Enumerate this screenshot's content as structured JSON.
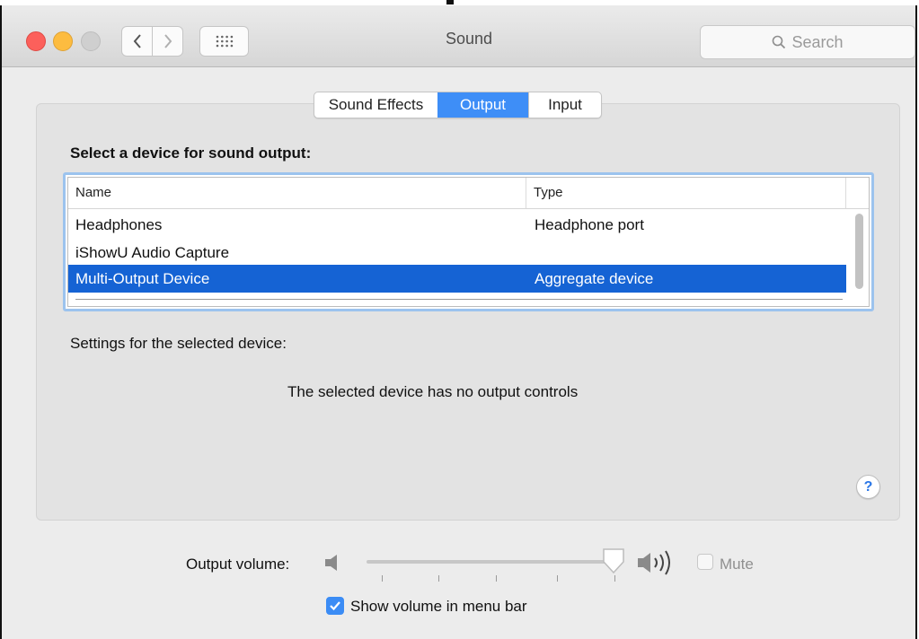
{
  "window": {
    "title": "Sound",
    "search_placeholder": "Search"
  },
  "icons": {
    "close": "close-light",
    "minimize": "minimize-light",
    "zoom": "zoom-light-disabled",
    "back": "chevron-left-icon",
    "forward": "chevron-right-icon",
    "show_all": "grid-icon",
    "search": "magnifier-icon",
    "help": "question-icon",
    "speaker_low": "speaker-low-icon",
    "speaker_high": "speaker-high-icon",
    "check": "checkmark-icon"
  },
  "tabs": [
    {
      "label": "Sound Effects",
      "selected": false
    },
    {
      "label": "Output",
      "selected": true
    },
    {
      "label": "Input",
      "selected": false
    }
  ],
  "output": {
    "heading": "Select a device for sound output:",
    "columns": [
      "Name",
      "Type"
    ],
    "devices": [
      {
        "name": "Headphones",
        "type": "Headphone port",
        "selected": false
      },
      {
        "name": "iShowU Audio Capture",
        "type": "",
        "selected": false
      },
      {
        "name": "Multi-Output Device",
        "type": "Aggregate device",
        "selected": true
      }
    ],
    "settings_label": "Settings for the selected device:",
    "no_controls_message": "The selected device has no output controls"
  },
  "volume": {
    "label": "Output volume:",
    "level_fraction": 0.96,
    "mute_label": "Mute",
    "mute_checked": false,
    "show_in_menu_bar_label": "Show volume in menu bar",
    "show_in_menu_bar_checked": true
  },
  "colors": {
    "accent": "#3e8ef7",
    "selection": "#1563d4",
    "close": "#fc605b",
    "minimize": "#fdbc40"
  }
}
